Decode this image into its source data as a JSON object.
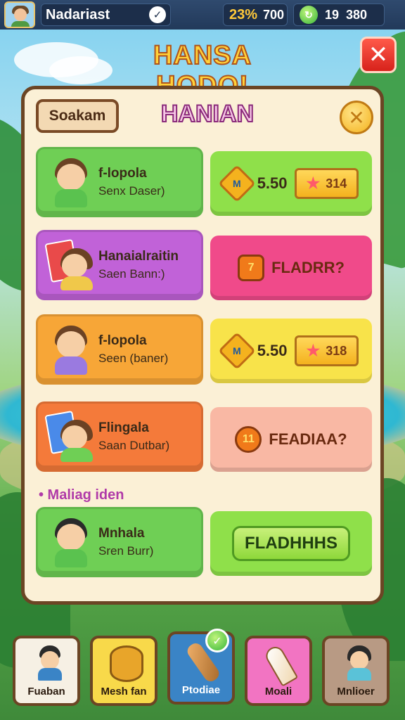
{
  "status_bar": {
    "player_name": "Nadariast",
    "stat1_value": "23%",
    "stat1_extra": "700",
    "stat2_a": "19",
    "stat2_b": "380"
  },
  "header": {
    "title": "HANSA HODO!"
  },
  "panel": {
    "tab_label": "Soakam",
    "title": "HANIAN"
  },
  "rows": [
    {
      "card_line1": "f-lopola",
      "card_line2": "Senx Daser)",
      "card_color": "#6fcf55",
      "reward_type": "coins",
      "reward_coin": "M",
      "reward_amount": "5.50",
      "reward_tag": "314",
      "reward_color": "#8fe04a"
    },
    {
      "card_line1": "Hanaialraitin",
      "card_line2": "Saen Bann:)",
      "card_color": "#c162d8",
      "reward_type": "bag",
      "reward_icon_text": "7",
      "reward_label": "FLADRR?",
      "reward_color": "#f04a8a"
    },
    {
      "card_line1": "f-lopola",
      "card_line2": "Seen (baner)",
      "card_color": "#f7a637",
      "reward_type": "coins",
      "reward_coin": "M",
      "reward_amount": "5.50",
      "reward_tag": "318",
      "reward_color": "#f8e34a"
    },
    {
      "card_line1": "Flingala",
      "card_line2": "Saan Dutbar)",
      "card_color": "#f47a3a",
      "reward_type": "bag",
      "reward_icon_text": "11",
      "reward_label": "FEADIAA?",
      "reward_color": "#f9b8a4"
    }
  ],
  "section_label": "• Maliag iden",
  "last_row": {
    "card_line1": "Mnhala",
    "card_line2": "Sren Burr)",
    "card_color": "#6fcf55",
    "button_label": "FLADHHHS",
    "reward_color": "#8fe04a"
  },
  "bottom_nav": [
    {
      "label": "Fuaban",
      "color": "#f6f0e4"
    },
    {
      "label": "Mesh fan",
      "color": "#f8d94a"
    },
    {
      "label": "Ptodiae",
      "color": "#3a84c6"
    },
    {
      "label": "Moali",
      "color": "#f274c2"
    },
    {
      "label": "Mnlioer",
      "color": "#b89a84"
    }
  ]
}
